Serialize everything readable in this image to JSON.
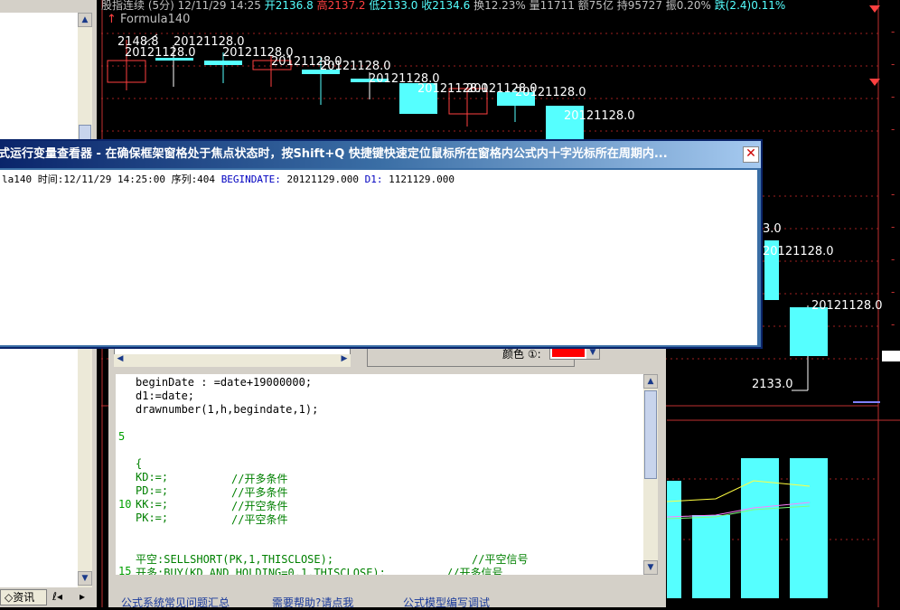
{
  "quote_bar": {
    "title": "股指连续 (5分) 12/11/29 14:25",
    "open": "开2136.8",
    "high": "高2137.2",
    "low": "低2133.0",
    "close": "收2134.6",
    "turnover": "换12.23%",
    "volume": "量11711",
    "amount": "额75亿",
    "hold": "持95727",
    "amplitude": "振0.20%",
    "change": "跌(2.4)0.11%"
  },
  "formula_title": "Formula140",
  "chart_labels": {
    "high_label": "2148.8",
    "low_label": "2133.0",
    "low_label_mid": "3.0",
    "date_value": "20121128.0"
  },
  "viewer": {
    "title": "式运行变量查看器 - 在确保框架窗格处于焦点状态时，按Shift+Q 快捷键快速定位鼠标所在窗格内公式内十字光标所在周期内...",
    "close": "✕",
    "line_prefix": "la140 时间:12/11/29 14:25:00 序列:404",
    "var1_name": "BEGINDATE:",
    "var1_value": "20121129.000",
    "var2_name": "D1:",
    "var2_value": "1121129.000"
  },
  "editor": {
    "color_label": "颜色 ①:",
    "lines": {
      "l1": "beginDate : =date+19000000;",
      "l2": "d1:=date;",
      "l3": "drawnumber(1,h,begindate,1);",
      "l5": "{",
      "l6a": "KD:=;",
      "l6b": "//开多条件",
      "l7a": "PD:=;",
      "l7b": "//平多条件",
      "l8a": "KK:=;",
      "l8b": "//开空条件",
      "l9a": "PK:=;",
      "l9b": "//平空条件",
      "l11a": "平空:SELLSHORT(PK,1,THISCLOSE);",
      "l11b": "//平空信号",
      "l12a": "开多:BUY(KD AND HOLDING=0,1,THISCLOSE);",
      "l12b": "//开多信号"
    },
    "line_numbers": {
      "n5": "5",
      "n10": "10",
      "n15": "15"
    }
  },
  "links": {
    "faq": "公式系统常见问题汇总",
    "help": "需要帮助?请点我",
    "debug": "公式模型编写调试"
  },
  "left_panel": {
    "tab": "资讯"
  },
  "colors": {
    "accent": "#55ffff",
    "up": "#ff4040",
    "down": "#55ffff",
    "title_bar": "#0a246a"
  }
}
